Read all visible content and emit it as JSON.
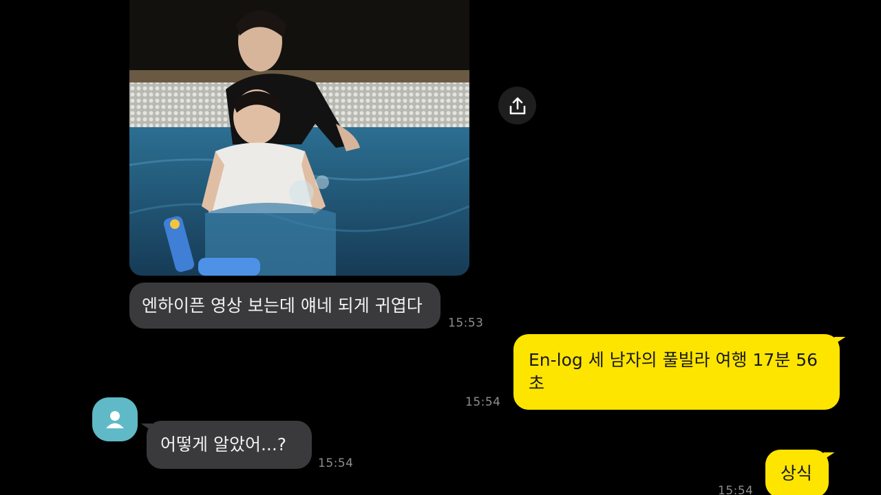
{
  "messages": [
    {
      "id": "m1",
      "side": "in",
      "type": "image",
      "icon": "share-icon"
    },
    {
      "id": "m2",
      "side": "in",
      "text": "엔하이픈 영상 보는데 얘네 되게 귀엽다",
      "time": "15:53"
    },
    {
      "id": "m3",
      "side": "out",
      "text": "En-log 세 남자의 풀빌라 여행 17분 56초",
      "time": "15:54"
    },
    {
      "id": "m4",
      "side": "in",
      "text": "어떻게 알았어...?",
      "time": "15:54",
      "avatar": "user-avatar-icon"
    },
    {
      "id": "m5",
      "side": "out",
      "text": "상식",
      "time": "15:54"
    }
  ],
  "colors": {
    "background": "#000000",
    "incoming_bubble": "#3a3a3c",
    "outgoing_bubble": "#fee500",
    "timestamp": "#8e8e93",
    "avatar": "#5fb9c6"
  }
}
